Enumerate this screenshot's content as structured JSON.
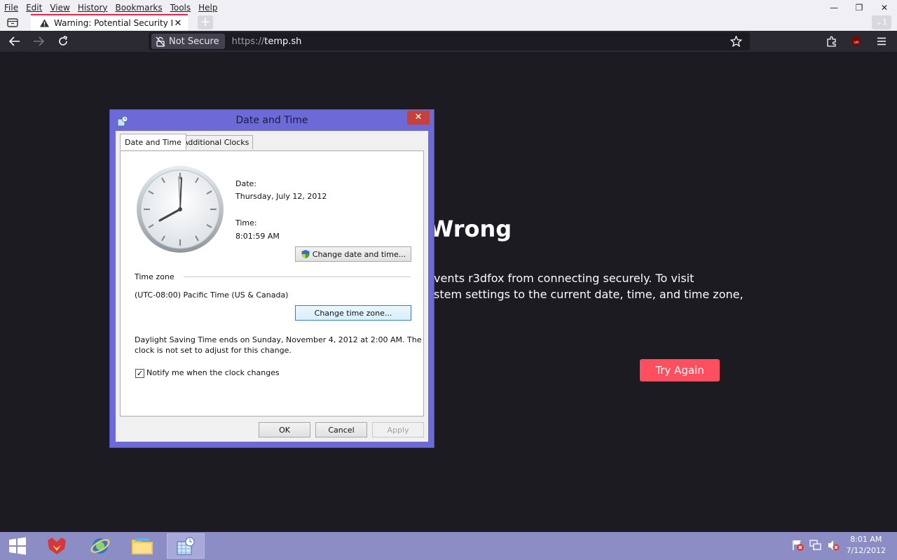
{
  "menu": [
    "File",
    "Edit",
    "View",
    "History",
    "Bookmarks",
    "Tools",
    "Help"
  ],
  "window_controls": {
    "minimize": "—",
    "restore": "❐",
    "close": "✕"
  },
  "tab": {
    "title": "Warning: Potential Security Risk",
    "close": "✕"
  },
  "tabs_overflow": "1",
  "newtab_label": "+",
  "nav": {
    "not_secure": "Not Secure",
    "url_protocol": "https://",
    "url_host": "temp.sh"
  },
  "error_page": {
    "heading": "Wrong",
    "line1": "vents r3dfox from connecting securely. To visit",
    "line2": "stem settings to the current date, time, and time zone,",
    "try_again": "Try Again"
  },
  "dialog": {
    "title": "Date and Time",
    "close": "✕",
    "tabs": [
      "Date and Time",
      "Additional Clocks"
    ],
    "date_label": "Date:",
    "date_value": "Thursday, July 12, 2012",
    "time_label": "Time:",
    "time_value": "8:01:59 AM",
    "change_datetime_btn": "Change date and time...",
    "timezone_label": "Time zone",
    "timezone_value": "(UTC-08:00) Pacific Time (US & Canada)",
    "change_timezone_btn": "Change time zone...",
    "dst_line1": "Daylight Saving Time ends on Sunday, November 4, 2012 at 2:00 AM. The",
    "dst_line2": "clock is not set to adjust for this change.",
    "notify_label": "Notify me when the clock changes",
    "notify_checked": "✓",
    "ok": "OK",
    "cancel": "Cancel",
    "apply": "Apply"
  },
  "taskbar": {
    "clock_time": "8:01 AM",
    "clock_date": "7/12/2012",
    "items": [
      "start-icon",
      "r3dfox-icon",
      "ie-icon",
      "file-explorer-icon",
      "date-time-icon"
    ]
  },
  "colors": {
    "accent_red": "#ff4f5e",
    "dialog_frame": "#6b6ad7",
    "taskbar": "#8d8dc6",
    "page_bg": "#1c1b22"
  }
}
